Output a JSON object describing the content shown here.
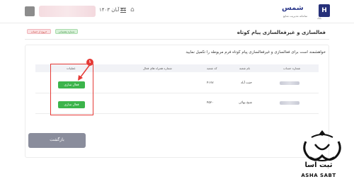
{
  "header": {
    "date": "۲۱ آبان ۱۴۰۳",
    "brand_name": "شمس",
    "brand_sub": "سامانه مدیریت منابع",
    "bank_initial": "H",
    "bank_sub": "بانک"
  },
  "badges": {
    "green": "شماره پشتیبانی",
    "red": "خروج از حساب"
  },
  "page": {
    "title": "فعالسازی و غیرفعالسازی پیام کوتاه",
    "instruction": "خواهشمند است برای فعالسازی و غیرفعالسازی پیام کوتاه فرم مربوطه را تکمیل نمایید"
  },
  "table": {
    "headers": {
      "account": "شماره حساب",
      "branch_name": "نام شعبه",
      "branch_code": "کد شعبه",
      "mobile": "شماره همراه های فعال",
      "actions": "عملیات"
    },
    "rows": [
      {
        "branch_name": "جنت آباد",
        "branch_code": "۴۱۷۷",
        "action_label": "فعال سازی"
      },
      {
        "branch_name": "شیخ بهائی",
        "branch_code": "۴۵۲۰",
        "action_label": "فعال سازی"
      }
    ]
  },
  "marker_number": "۱",
  "back_label": "بازگشت",
  "watermark": {
    "text": "ثبت آسا",
    "sub": "ASHA SABT"
  }
}
